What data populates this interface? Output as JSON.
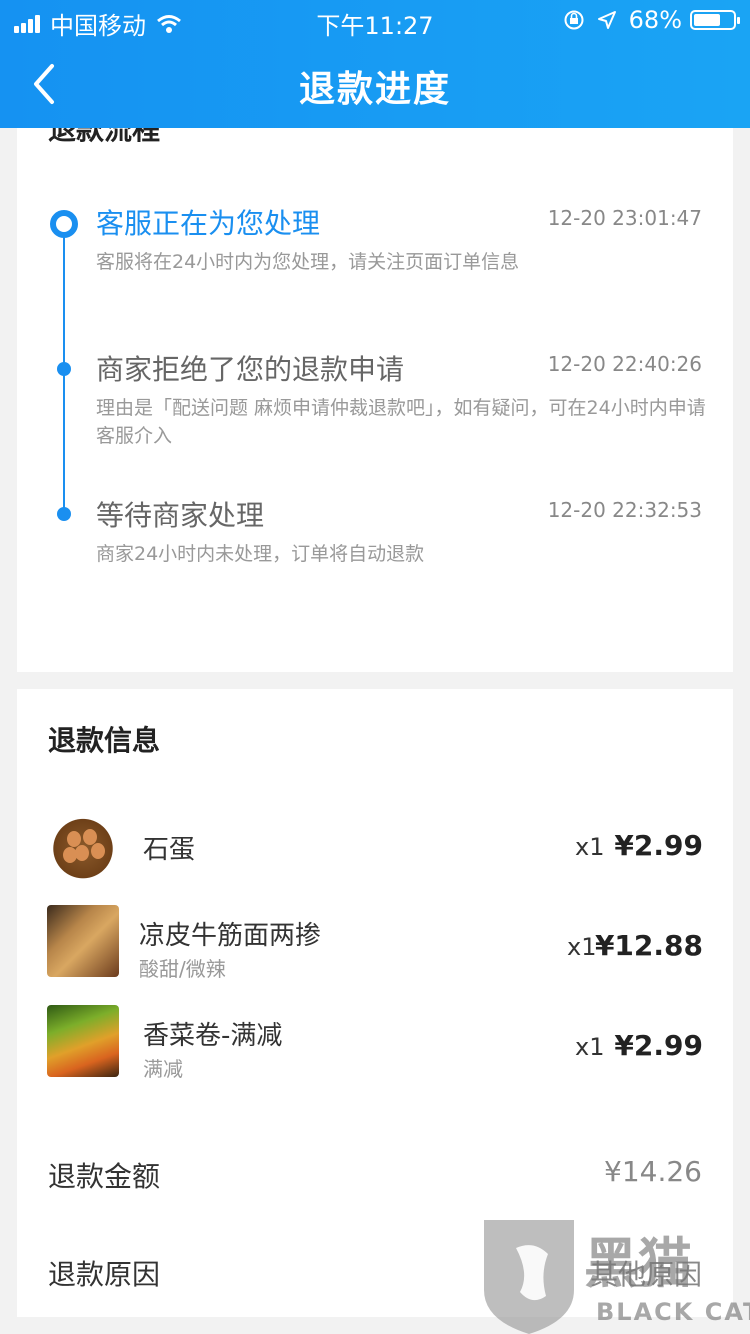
{
  "status_bar": {
    "carrier": "中国移动",
    "time": "下午11:27",
    "battery": "68%",
    "battery_level": 0.68
  },
  "nav": {
    "title": "退款进度",
    "back_icon": "chevron-left-icon"
  },
  "progress": {
    "section_title": "退款流程",
    "steps": [
      {
        "title": "客服正在为您处理",
        "time": "12-20 23:01:47",
        "desc": "客服将在24小时内为您处理，请关注页面订单信息"
      },
      {
        "title": "商家拒绝了您的退款申请",
        "time": "12-20 22:40:26",
        "desc": "理由是「配送问题 麻烦申请仲裁退款吧」，如有疑问，可在24小时内申请客服介入"
      },
      {
        "title": "等待商家处理",
        "time": "12-20 22:32:53",
        "desc": "商家24小时内未处理，订单将自动退款"
      }
    ]
  },
  "refund_info": {
    "section_title": "退款信息",
    "items": [
      {
        "name": "石蛋",
        "sub": "",
        "qty": "x1",
        "price": "¥2.99"
      },
      {
        "name": "凉皮牛筋面两掺",
        "sub": "酸甜/微辣",
        "qty": "x1",
        "price": "¥12.88"
      },
      {
        "name": "香菜卷-满减",
        "sub": "满减",
        "qty": "x1",
        "price": "¥2.99"
      }
    ],
    "amount_label": "退款金额",
    "amount_value": "¥14.26",
    "reason_label": "退款原因",
    "reason_value": "其他原因"
  },
  "watermark": {
    "text_cn": "黑猫",
    "text_en": "BLACK CAT"
  },
  "colors": {
    "accent": "#1a8ff0",
    "header": "#1592f2"
  }
}
